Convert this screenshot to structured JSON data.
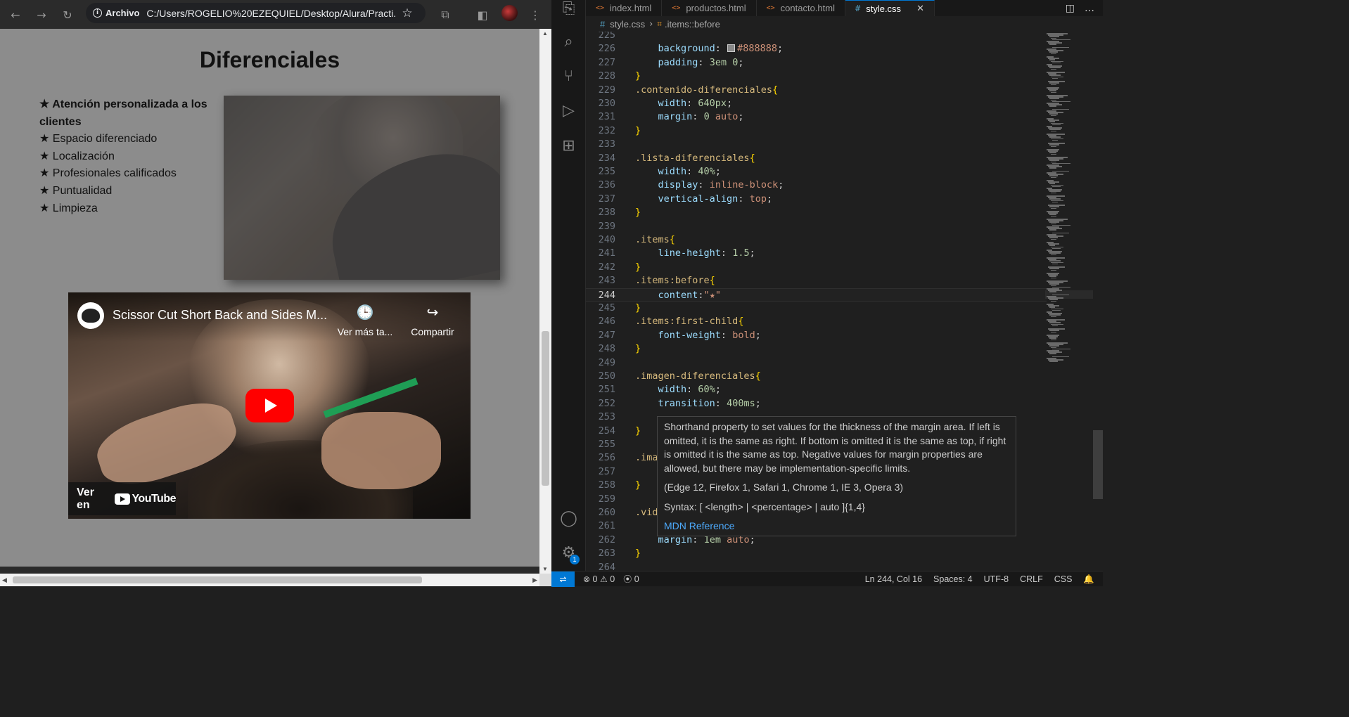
{
  "browser": {
    "site_chip": "Archivo",
    "url": "C:/Users/ROGELIO%20EZEQUIEL/Desktop/Alura/Practi...",
    "page": {
      "title": "Diferenciales",
      "items": [
        "★ Atención personalizada a los clientes",
        "★ Espacio diferenciado",
        "★ Localización",
        "★ Profesionales calificados",
        "★ Puntualidad",
        "★ Limpieza"
      ],
      "video": {
        "title": "Scissor Cut Short Back and Sides M...",
        "watch_later": "Ver más ta...",
        "share": "Compartir",
        "watch_on": "Ver en",
        "youtube": "YouTube"
      }
    },
    "icons": [
      "back-icon",
      "forward-icon",
      "reload-icon",
      "info-icon",
      "star-icon",
      "extensions-icon",
      "side-panel-icon",
      "menu-icon"
    ]
  },
  "vscode": {
    "tabs": [
      {
        "label": "index.html",
        "icon": "<>"
      },
      {
        "label": "productos.html",
        "icon": "<>"
      },
      {
        "label": "contacto.html",
        "icon": "<>"
      },
      {
        "label": "style.css",
        "icon": "#",
        "active": true
      }
    ],
    "breadcrumb": {
      "file": "style.css",
      "symbol": ".items::before"
    },
    "lines": [
      {
        "n": "225",
        "segs": []
      },
      {
        "n": "226",
        "segs": [
          {
            "t": "    "
          },
          {
            "t": "background",
            "c": "prop"
          },
          {
            "t": ": ",
            "c": "pun"
          },
          {
            "sw": true
          },
          {
            "t": "#888888",
            "c": "val"
          },
          {
            "t": ";",
            "c": "pun"
          }
        ]
      },
      {
        "n": "227",
        "segs": [
          {
            "t": "    "
          },
          {
            "t": "padding",
            "c": "prop"
          },
          {
            "t": ": ",
            "c": "pun"
          },
          {
            "t": "3em",
            "c": "num"
          },
          {
            "t": " ",
            "c": "pun"
          },
          {
            "t": "0",
            "c": "num"
          },
          {
            "t": ";",
            "c": "pun"
          }
        ]
      },
      {
        "n": "228",
        "segs": [
          {
            "t": "}",
            "c": "br"
          }
        ]
      },
      {
        "n": "229",
        "segs": [
          {
            "t": ".contenido-diferenciales",
            "c": "sel"
          },
          {
            "t": "{",
            "c": "br"
          }
        ]
      },
      {
        "n": "230",
        "segs": [
          {
            "t": "    "
          },
          {
            "t": "width",
            "c": "prop"
          },
          {
            "t": ": ",
            "c": "pun"
          },
          {
            "t": "640px",
            "c": "num"
          },
          {
            "t": ";",
            "c": "pun"
          }
        ]
      },
      {
        "n": "231",
        "segs": [
          {
            "t": "    "
          },
          {
            "t": "margin",
            "c": "prop"
          },
          {
            "t": ": ",
            "c": "pun"
          },
          {
            "t": "0",
            "c": "num"
          },
          {
            "t": " auto",
            "c": "val"
          },
          {
            "t": ";",
            "c": "pun"
          }
        ]
      },
      {
        "n": "232",
        "segs": [
          {
            "t": "}",
            "c": "br"
          }
        ]
      },
      {
        "n": "233",
        "segs": []
      },
      {
        "n": "234",
        "segs": [
          {
            "t": ".lista-diferenciales",
            "c": "sel"
          },
          {
            "t": "{",
            "c": "br"
          }
        ]
      },
      {
        "n": "235",
        "segs": [
          {
            "t": "    "
          },
          {
            "t": "width",
            "c": "prop"
          },
          {
            "t": ": ",
            "c": "pun"
          },
          {
            "t": "40%",
            "c": "num"
          },
          {
            "t": ";",
            "c": "pun"
          }
        ]
      },
      {
        "n": "236",
        "segs": [
          {
            "t": "    "
          },
          {
            "t": "display",
            "c": "prop"
          },
          {
            "t": ": ",
            "c": "pun"
          },
          {
            "t": "inline-block",
            "c": "val"
          },
          {
            "t": ";",
            "c": "pun"
          }
        ]
      },
      {
        "n": "237",
        "segs": [
          {
            "t": "    "
          },
          {
            "t": "vertical-align",
            "c": "prop"
          },
          {
            "t": ": ",
            "c": "pun"
          },
          {
            "t": "top",
            "c": "val"
          },
          {
            "t": ";",
            "c": "pun"
          }
        ]
      },
      {
        "n": "238",
        "segs": [
          {
            "t": "}",
            "c": "br"
          }
        ]
      },
      {
        "n": "239",
        "segs": []
      },
      {
        "n": "240",
        "segs": [
          {
            "t": ".items",
            "c": "sel"
          },
          {
            "t": "{",
            "c": "br"
          }
        ]
      },
      {
        "n": "241",
        "segs": [
          {
            "t": "    "
          },
          {
            "t": "line-height",
            "c": "prop"
          },
          {
            "t": ": ",
            "c": "pun"
          },
          {
            "t": "1.5",
            "c": "num"
          },
          {
            "t": ";",
            "c": "pun"
          }
        ]
      },
      {
        "n": "242",
        "segs": [
          {
            "t": "}",
            "c": "br"
          }
        ]
      },
      {
        "n": "243",
        "segs": [
          {
            "t": ".items:before",
            "c": "sel"
          },
          {
            "t": "{",
            "c": "br"
          }
        ]
      },
      {
        "n": "244",
        "current": true,
        "segs": [
          {
            "t": "    "
          },
          {
            "t": "content",
            "c": "prop"
          },
          {
            "t": ":",
            "c": "pun"
          },
          {
            "t": "\"★\"",
            "c": "val"
          }
        ]
      },
      {
        "n": "245",
        "segs": [
          {
            "t": "}",
            "c": "br"
          }
        ]
      },
      {
        "n": "246",
        "segs": [
          {
            "t": ".items:first-child",
            "c": "sel"
          },
          {
            "t": "{",
            "c": "br"
          }
        ]
      },
      {
        "n": "247",
        "segs": [
          {
            "t": "    "
          },
          {
            "t": "font-weight",
            "c": "prop"
          },
          {
            "t": ": ",
            "c": "pun"
          },
          {
            "t": "bold",
            "c": "val"
          },
          {
            "t": ";",
            "c": "pun"
          }
        ]
      },
      {
        "n": "248",
        "segs": [
          {
            "t": "}",
            "c": "br"
          }
        ]
      },
      {
        "n": "249",
        "segs": []
      },
      {
        "n": "250",
        "segs": [
          {
            "t": ".imagen-diferenciales",
            "c": "sel"
          },
          {
            "t": "{",
            "c": "br"
          }
        ]
      },
      {
        "n": "251",
        "segs": [
          {
            "t": "    "
          },
          {
            "t": "width",
            "c": "prop"
          },
          {
            "t": ": ",
            "c": "pun"
          },
          {
            "t": "60%",
            "c": "num"
          },
          {
            "t": ";",
            "c": "pun"
          }
        ]
      },
      {
        "n": "252",
        "segs": [
          {
            "t": "    "
          },
          {
            "t": "transition",
            "c": "prop"
          },
          {
            "t": ": ",
            "c": "pun"
          },
          {
            "t": "400ms",
            "c": "num"
          },
          {
            "t": ";",
            "c": "pun"
          }
        ]
      },
      {
        "n": "253",
        "segs": []
      },
      {
        "n": "254",
        "segs": [
          {
            "t": "}",
            "c": "br"
          }
        ]
      },
      {
        "n": "255",
        "segs": []
      },
      {
        "n": "256",
        "segs": [
          {
            "t": ".ima",
            "c": "sel"
          }
        ]
      },
      {
        "n": "257",
        "segs": []
      },
      {
        "n": "258",
        "segs": [
          {
            "t": "}",
            "c": "br"
          }
        ]
      },
      {
        "n": "259",
        "segs": []
      },
      {
        "n": "260",
        "segs": [
          {
            "t": ".vid",
            "c": "sel"
          }
        ]
      },
      {
        "n": "261",
        "segs": []
      },
      {
        "n": "262",
        "segs": [
          {
            "t": "    "
          },
          {
            "t": "margin",
            "c": "prop"
          },
          {
            "t": ": ",
            "c": "pun"
          },
          {
            "t": "1em",
            "c": "num"
          },
          {
            "t": " auto",
            "c": "val"
          },
          {
            "t": ";",
            "c": "pun"
          }
        ]
      },
      {
        "n": "263",
        "segs": [
          {
            "t": "}",
            "c": "br"
          }
        ]
      },
      {
        "n": "264",
        "segs": []
      }
    ],
    "hover": {
      "description": "Shorthand property to set values for the thickness of the margin area. If left is omitted, it is the same as right. If bottom is omitted it is the same as top, if right is omitted it is the same as top. Negative values for margin properties are allowed, but there may be implementation-specific limits.",
      "browsers": "(Edge 12, Firefox 1, Safari 1, Chrome 1, IE 3, Opera 3)",
      "syntax": "Syntax: [ <length> | <percentage> | auto ]{1,4}",
      "link": "MDN Reference"
    },
    "status": {
      "errors": "0",
      "warnings": "0",
      "ports": "0",
      "position": "Ln 244, Col 16",
      "spaces": "Spaces: 4",
      "encoding": "UTF-8",
      "eol": "CRLF",
      "language": "CSS"
    },
    "accounts_badge": "1"
  },
  "colors": {
    "accent": "#0078d4",
    "page_bg": "#8c8c8c",
    "swatch": "#888888"
  }
}
